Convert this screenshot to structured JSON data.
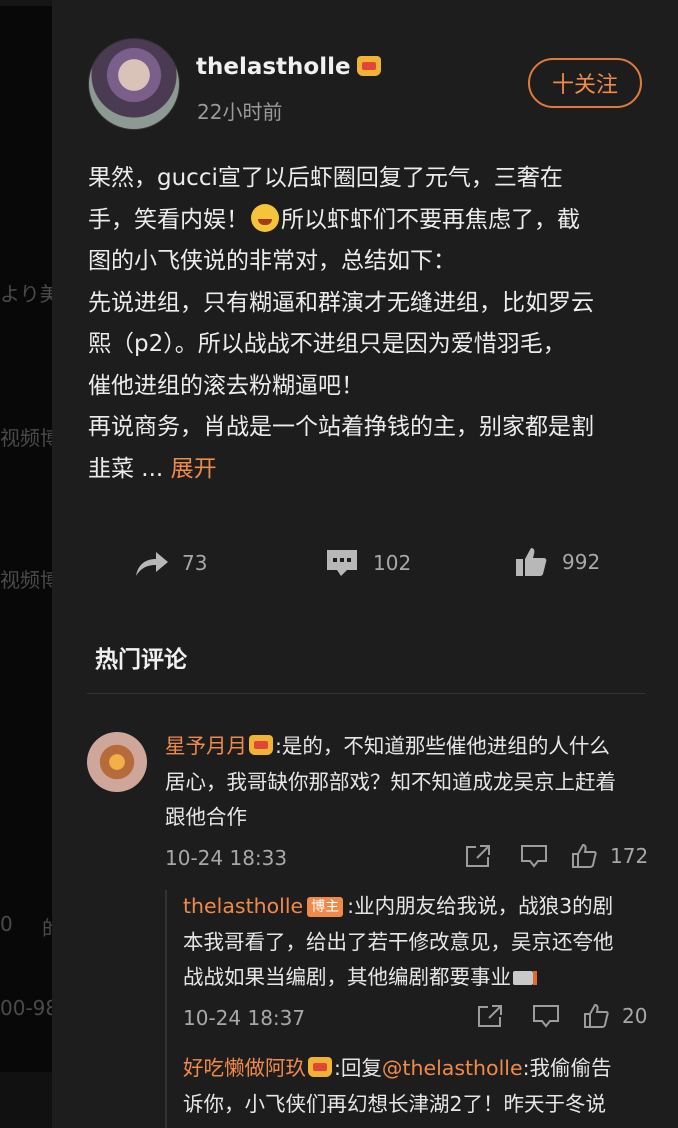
{
  "background_left": {
    "fragments": [
      "より美",
      "视频博",
      "视频博",
      "0",
      "的",
      "00-98"
    ]
  },
  "post": {
    "username": "thelastholle",
    "time": "22小时前",
    "follow_label": "十关注",
    "body_lines": [
      "果然，gucci宣了以后虾圈回复了元气，三奢在",
      "所以虾虾们不要再焦虑了，截",
      "手，笑看内娱！",
      "图的小飞侠说的非常对，总结如下：",
      "先说进组，只有糊逼和群演才无缝进组，比如罗云",
      "熙（p2）。所以战战不进组只是因为爱惜羽毛，",
      "催他进组的滚去粉糊逼吧！",
      "再说商务，肖战是一个站着挣钱的主，别家都是割",
      "韭菜 ... ",
      "展开"
    ],
    "stats": {
      "repost": "73",
      "comment": "102",
      "like": "992"
    }
  },
  "hot_comments": {
    "title": "热门评论",
    "items": [
      {
        "username": "星予月月",
        "text_line1": ":是的，不知道那些催他进组的人什么",
        "text_line2": "居心，我哥缺你那部戏？知不知道成龙吴京上赶着",
        "text_line3": "跟他合作",
        "time": "10-24 18:33",
        "likes": "172"
      }
    ],
    "replies": [
      {
        "username": "thelastholle",
        "tag": "博主",
        "text_line1": ":业内朋友给我说，战狼3的剧",
        "text_line2": "本我哥看了，给出了若干修改意见，吴京还夸他",
        "text_line3": "战战如果当编剧，其他编剧都要事业",
        "time": "10-24 18:37",
        "likes": "20"
      },
      {
        "username": "好吃懒做阿玖",
        "reply_prefix": ":回复",
        "mention": "@thelastholle",
        "text_line1": ":我偷偷告",
        "text_line2": "诉你，小飞侠们再幻想长津湖2了！昨天于冬说"
      }
    ]
  },
  "colors": {
    "accent": "#f08a48",
    "panel_bg": "#1d1d1d",
    "text": "#ececec",
    "muted": "#a8a8a8"
  }
}
